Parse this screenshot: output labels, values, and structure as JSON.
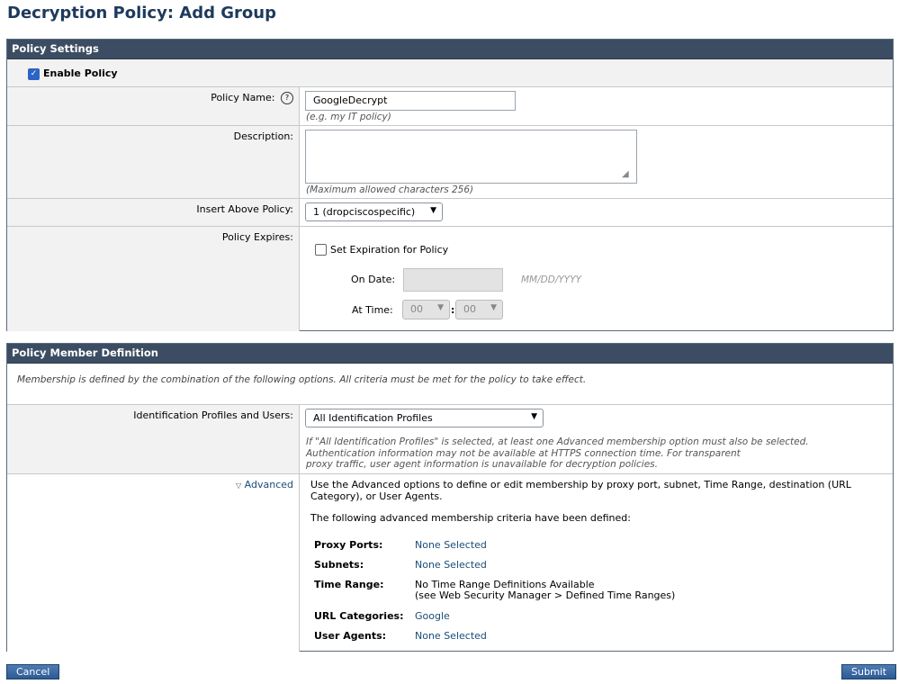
{
  "page_title": "Decryption Policy: Add Group",
  "policy_settings": {
    "header": "Policy Settings",
    "enable_label": "Enable Policy",
    "enable_checked": true,
    "policy_name_label": "Policy Name:",
    "help_icon": "?",
    "policy_name_value": "GoogleDecrypt",
    "policy_name_hint": "(e.g. my IT policy)",
    "description_label": "Description:",
    "description_value": "",
    "description_hint": "(Maximum allowed characters 256)",
    "insert_above_label": "Insert Above Policy:",
    "insert_above_value": "1 (dropciscospecific)",
    "expires_label": "Policy Expires:",
    "set_expiration_label": "Set Expiration for Policy",
    "on_date_label": "On Date:",
    "date_placeholder": "MM/DD/YYYY",
    "at_time_label": "At Time:",
    "hour_value": "00",
    "time_sep": ":",
    "minute_value": "00"
  },
  "member_definition": {
    "header": "Policy Member Definition",
    "intro": "Membership is defined by the combination of the following options. All criteria must be met for the policy to take effect.",
    "id_profiles_label": "Identification Profiles and Users:",
    "id_profiles_value": "All Identification Profiles",
    "id_profiles_note_1": "If \"All Identification Profiles\" is selected, at least one Advanced membership option must also be selected.",
    "id_profiles_note_2": "Authentication information may not be available at HTTPS connection time. For transparent",
    "id_profiles_note_3": "proxy traffic, user agent information is unavailable for decryption policies.",
    "advanced_label": "Advanced",
    "advanced_desc": "Use the Advanced options to define or edit membership by proxy port, subnet, Time Range, destination (URL Category), or User Agents.",
    "criteria_intro": "The following advanced membership criteria have been defined:",
    "criteria": [
      {
        "key": "Proxy Ports:",
        "value": "None Selected",
        "value2": ""
      },
      {
        "key": "Subnets:",
        "value": "None Selected",
        "value2": ""
      },
      {
        "key": "Time Range:",
        "value": "No Time Range Definitions Available",
        "value2": "(see Web Security Manager > Defined Time Ranges)"
      },
      {
        "key": "URL Categories:",
        "value": "Google",
        "value2": ""
      },
      {
        "key": "User Agents:",
        "value": "None Selected",
        "value2": ""
      }
    ]
  },
  "buttons": {
    "cancel": "Cancel",
    "submit": "Submit"
  },
  "colors": {
    "panel_header": "#3c4d63",
    "title": "#1d3a5c",
    "link": "#1a4d78",
    "button": "#2c5a94"
  }
}
